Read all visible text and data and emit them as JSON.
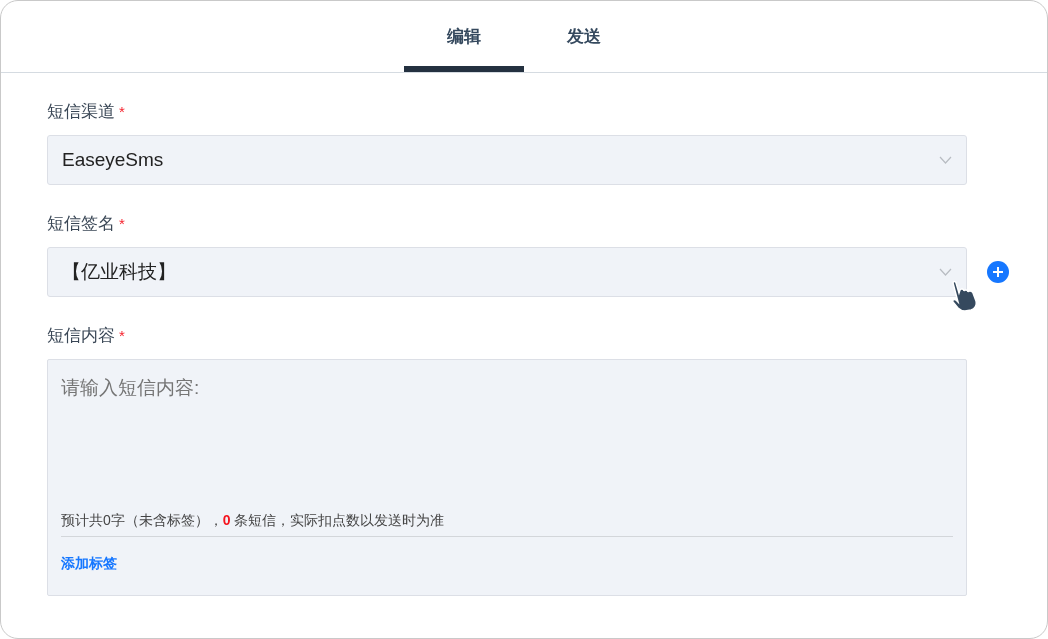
{
  "tabs": [
    {
      "label": "编辑",
      "selected": true
    },
    {
      "label": "发送",
      "selected": false
    }
  ],
  "fields": [
    {
      "label": "短信渠道",
      "required_mark": "*",
      "kind": "select",
      "value": "EaseyeSms",
      "addable": false
    },
    {
      "label": "短信签名",
      "required_mark": "*",
      "kind": "select",
      "value": "【亿业科技】",
      "addable": true
    },
    {
      "label": "短信内容",
      "required_mark": "*",
      "kind": "textarea",
      "placeholder": "请输入短信内容:",
      "counter": {
        "before": "预计共0字（未含标签），",
        "count": "0",
        "after": " 条短信，实际扣点数以发送时为准"
      },
      "link": "添加标签"
    }
  ]
}
